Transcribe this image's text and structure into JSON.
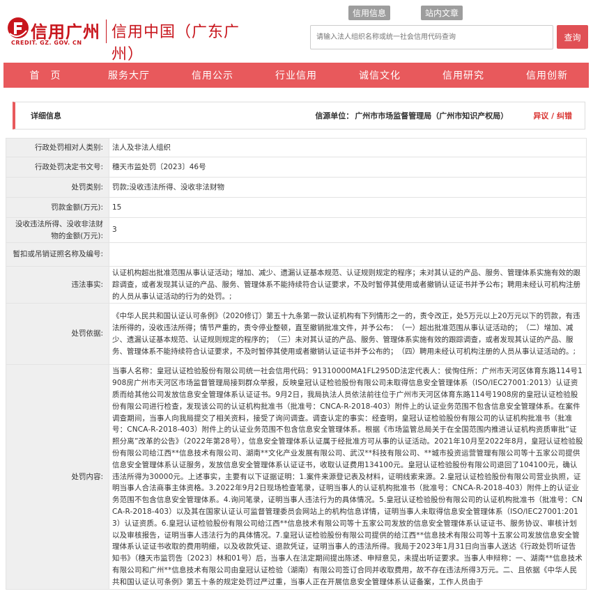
{
  "header": {
    "top_links": [
      "信用信息",
      "站内文章"
    ],
    "logo_text": "信用广州",
    "logo_subtitle": "CREDIT. GZ. GOV. CN",
    "site_name": "信用中国（广东广州）",
    "search_placeholder": "请输入法人组织名称或统一社会信用代码查询",
    "search_button": "查询"
  },
  "nav": {
    "items": [
      "首　页",
      "服务大厅",
      "信用公示",
      "行业信用",
      "诚信文化",
      "信用研究",
      "信用创新"
    ]
  },
  "info": {
    "title": "详细信息",
    "source_label": "信源单位：",
    "source_value": "广州市市场监督管理局（广州市知识产权局）",
    "report_link": "异议 / 纠错"
  },
  "rows": [
    {
      "label": "行政处罚相对人类别:",
      "value": "法人及非法人组织"
    },
    {
      "label": "行政处罚决定书文号:",
      "value": "穗天市监处罚〔2023〕46号"
    },
    {
      "label": "处罚类别:",
      "value": "罚款;没收违法所得、没收非法财物"
    },
    {
      "label": "罚款金额(万元):",
      "value": "15"
    },
    {
      "label": "没收违法所得、没收非法财物的金额(万元):",
      "value": "3"
    },
    {
      "label": "暂扣或吊销证照名称及编号:",
      "value": ""
    },
    {
      "label": "违法事实:",
      "value": "认证机构超出批准范围从事认证活动；增加、减少、遗漏认证基本规范、认证规则规定的程序；未对其认证的产品、服务、管理体系实施有效的跟踪调查，或者发现其认证的产品、服务、管理体系不能持续符合认证要求，不及时暂停其使用或者撤销认证证书并予公布；聘用未经认可机构注册的人员从事认证活动的行为的处罚。;"
    },
    {
      "label": "处罚依据:",
      "value": "《中华人民共和国认证认可条例》（2020修订）第五十九条第一款认证机构有下列情形之一的，责令改正，处5万元以上20万元以下的罚款，有违法所得的，没收违法所得；情节严重的，责令停业整顿，直至撤销批准文件，并予公布：　（一）超出批准范围从事认证活动的；　（二）增加、减少、遗漏认证基本规范、认证规则规定的程序的；　（三）未对其认证的产品、服务、管理体系实施有效的跟踪调查，或者发现其认证的产品、服务、管理体系不能持续符合认证要求，不及时暂停其使用或者撤销认证证书并予公布的；　（四）聘用未经认可机构注册的人员从事认证活动的。;"
    },
    {
      "label": "处罚内容:",
      "value": "当事人名称：皇冠认证检验股份有限公司统一社会信用代码：91310000MA1FL2950D法定代表人：侯恂住所：广州市天河区体育东路114号1908房广州市天河区市场监督管理局接到群众举报，反映皇冠认证检验股份有限公司未取得信息安全管理体系（ISO/IEC27001:2013）认证资质而给其他公司发放信息安全管理体系认证证书。9月2日，我局执法人员依法前往位于广州市天河区体育东路114号1908房的皇冠认证检验股份有限公司进行检查，发现该公司的认证机构批准书（批准号：CNCA-R-2018-403）附件上的认证业务范围不包含信息安全管理体系。在案件调查期间，当事人向我局提交了相关资料，接受了询问调查。调查认定的事实：经查明，皇冠认证检验股份有限公司的认证机构批准书（批准号：CNCA-R-2018-403）附件上的认证业务范围不包含信息安全管理体系。根据《市场监管总局关于在全国范围内推进认证机构资质审批“证照分离”改革的公告》（2022年第28号），信息安全管理体系认证属于经批准方可从事的认证活动。2021年10月至2022年8月，皇冠认证检验股份有限公司给江西**信息技术有限公司、湖南**文化产业发展有限公司、武汉**科技有限公司、**城市投资运营管理有限公司等十五家公司提供信息安全管理体系认证服务，发放信息安全管理体系认证证书，收取认证费用134100元。皇冠认证检验股份有限公司退回了104100元，确认违法所得为30000元。上述事实，主要有以下证据证明：1.案件来源登记表及材料，证明线索来源。2.皇冠认证检验股份有限公司营业执照，证明当事人合法商事主体资格。3.2022年9月2日现场检查笔录，证明当事人的认证机构批准书（批准号：CNCA-R-2018-403）附件上的认证业务范围不包含信息安全管理体系。4.询问笔录，证明当事人违法行为的具体情况。5.皇冠认证检验股份有限公司的认证机构批准书（批准号：CNCA-R-2018-403）以及其在国家认证认可监督管理委员会网站上的机构信息详情，证明当事人未取得信息安全管理体系（ISO/IEC27001:2013）认证资质。6.皇冠认证检验股份有限公司给江西**信息技术有限公司等十五家公司发放的信息安全管理体系认证证书、服务协议、审核计划以及审核报告，证明当事人违法行为的具体情况。7.皇冠认证检验股份有限公司提供的给江西**信息技术有限公司等十五家公司发放信息安全管理体系认证证书收取的费用明细，以及收款凭证、退款凭证，证明当事人的违法所得。我局于2023年1月31日向当事人送达《行政处罚听证告知书》（穗天市监罚告〔2023〕林和01号）后，当事人在法定期间提出陈述、申辩意见，未提出听证要求。当事人申辩称：一、湖南**信息技术有限公司和广州**信息技术有限公司由皇冠认证检验（湖南）有限公司签订合同并收取费用，故不存在违法所得3万元。二、且依据《中华人民共和国认证认可条例》第五十条的规定处罚过严过重，当事人正在开展信息安全管理体系认证备案，工作人员由于"
    }
  ]
}
